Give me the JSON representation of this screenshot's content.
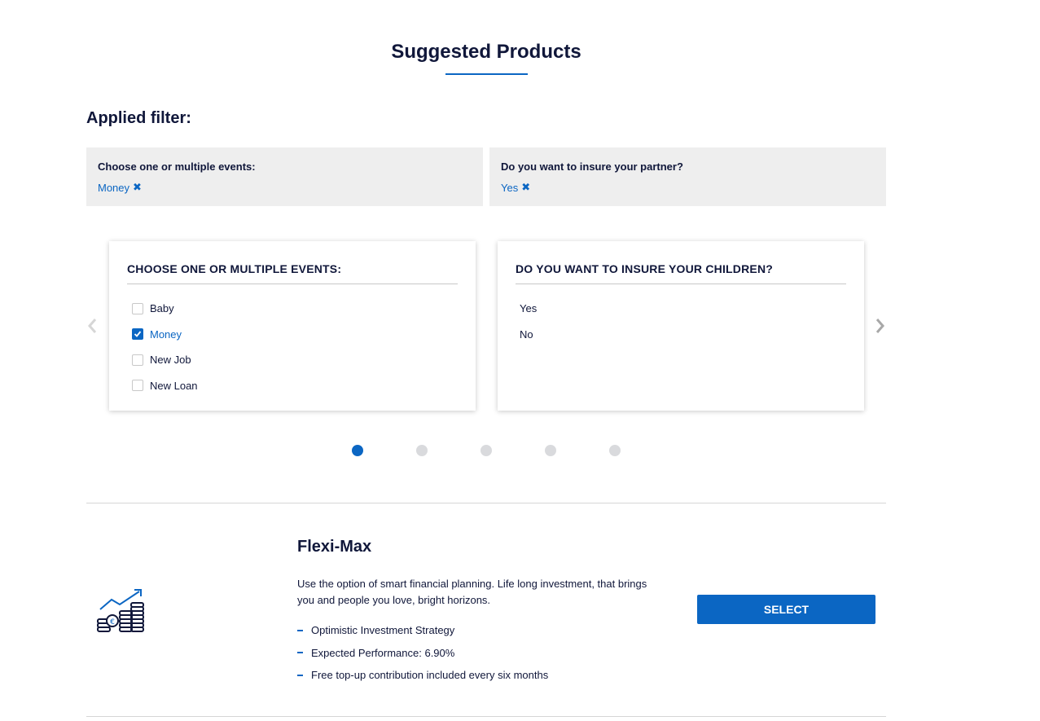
{
  "page": {
    "title": "Suggested Products",
    "applied_filter_label": "Applied filter:"
  },
  "applied_filters": [
    {
      "question": "Choose one or multiple events:",
      "chip": "Money"
    },
    {
      "question": "Do you want to insure your partner?",
      "chip": "Yes"
    }
  ],
  "question_cards": [
    {
      "title": "CHOOSE ONE OR MULTIPLE EVENTS:",
      "options": [
        {
          "label": "Baby",
          "checked": false
        },
        {
          "label": "Money",
          "checked": true
        },
        {
          "label": "New Job",
          "checked": false
        },
        {
          "label": "New Loan",
          "checked": false
        }
      ]
    },
    {
      "title": "DO YOU WANT TO INSURE YOUR CHILDREN?",
      "options": [
        {
          "label": "Yes"
        },
        {
          "label": "No"
        }
      ]
    }
  ],
  "pagination": {
    "total": 5,
    "active": 1
  },
  "product": {
    "name": "Flexi-Max",
    "icon": "investment-coins-growth-icon",
    "description": "Use the option of smart financial planning. Life long investment, that brings you and people you love, bright horizons.",
    "features": [
      "Optimistic Investment Strategy",
      "Expected Performance: 6.90%",
      "Free top-up contribution included every six months"
    ],
    "select_label": "SELECT"
  },
  "colors": {
    "accent": "#0b66c3",
    "heading": "#10173a",
    "filter_bg": "#eeeeee",
    "dot_inactive": "#d9dadd"
  }
}
